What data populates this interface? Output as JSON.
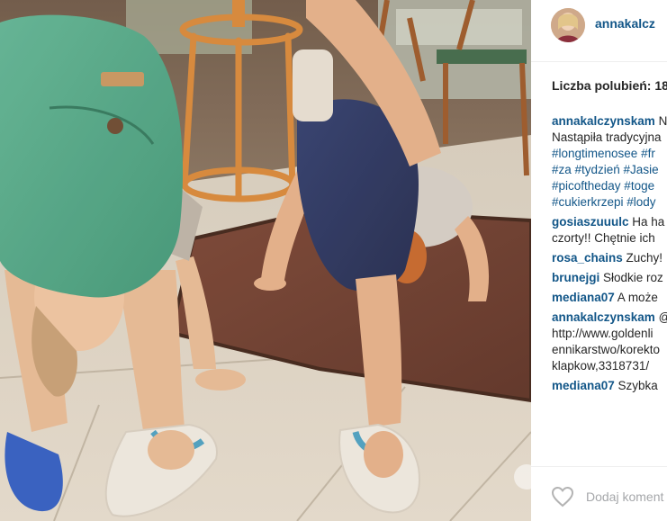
{
  "post": {
    "username": "annakalcz",
    "likes_label": "Liczba polubień: 18"
  },
  "caption": {
    "user": "annakalczynskam",
    "user_tail": " N",
    "line2": "Nastąpiła tradycyjna",
    "line3": "#longtimenosee #fr",
    "line4": "#za #tydzień #Jasie",
    "line5": "#picoftheday #toge",
    "line6": "#cukierkrzepi #lody"
  },
  "comments": [
    {
      "user": "gosiaszuuulc",
      "text": " Ha ha",
      "cont": "czorty!! Chętnie ich"
    },
    {
      "user": "rosa_chains",
      "text": " Zuchy!"
    },
    {
      "user": "brunejgi",
      "text": " Słodkie roz"
    },
    {
      "user": "mediana07",
      "text": " A może"
    },
    {
      "user": "annakalczynskam",
      "text": " @",
      "cont1": "http://www.goldenli",
      "cont2": "ennikarstwo/korekto",
      "cont3": "klapkow,3318731/"
    },
    {
      "user": "mediana07",
      "text": " Szybka"
    }
  ],
  "footer": {
    "add_comment": "Dodaj koment"
  },
  "icons": {
    "heart": "heart-icon",
    "avatar": "avatar"
  },
  "colors": {
    "username": "#125688",
    "text": "#262626",
    "placeholder": "#a5a7aa"
  }
}
